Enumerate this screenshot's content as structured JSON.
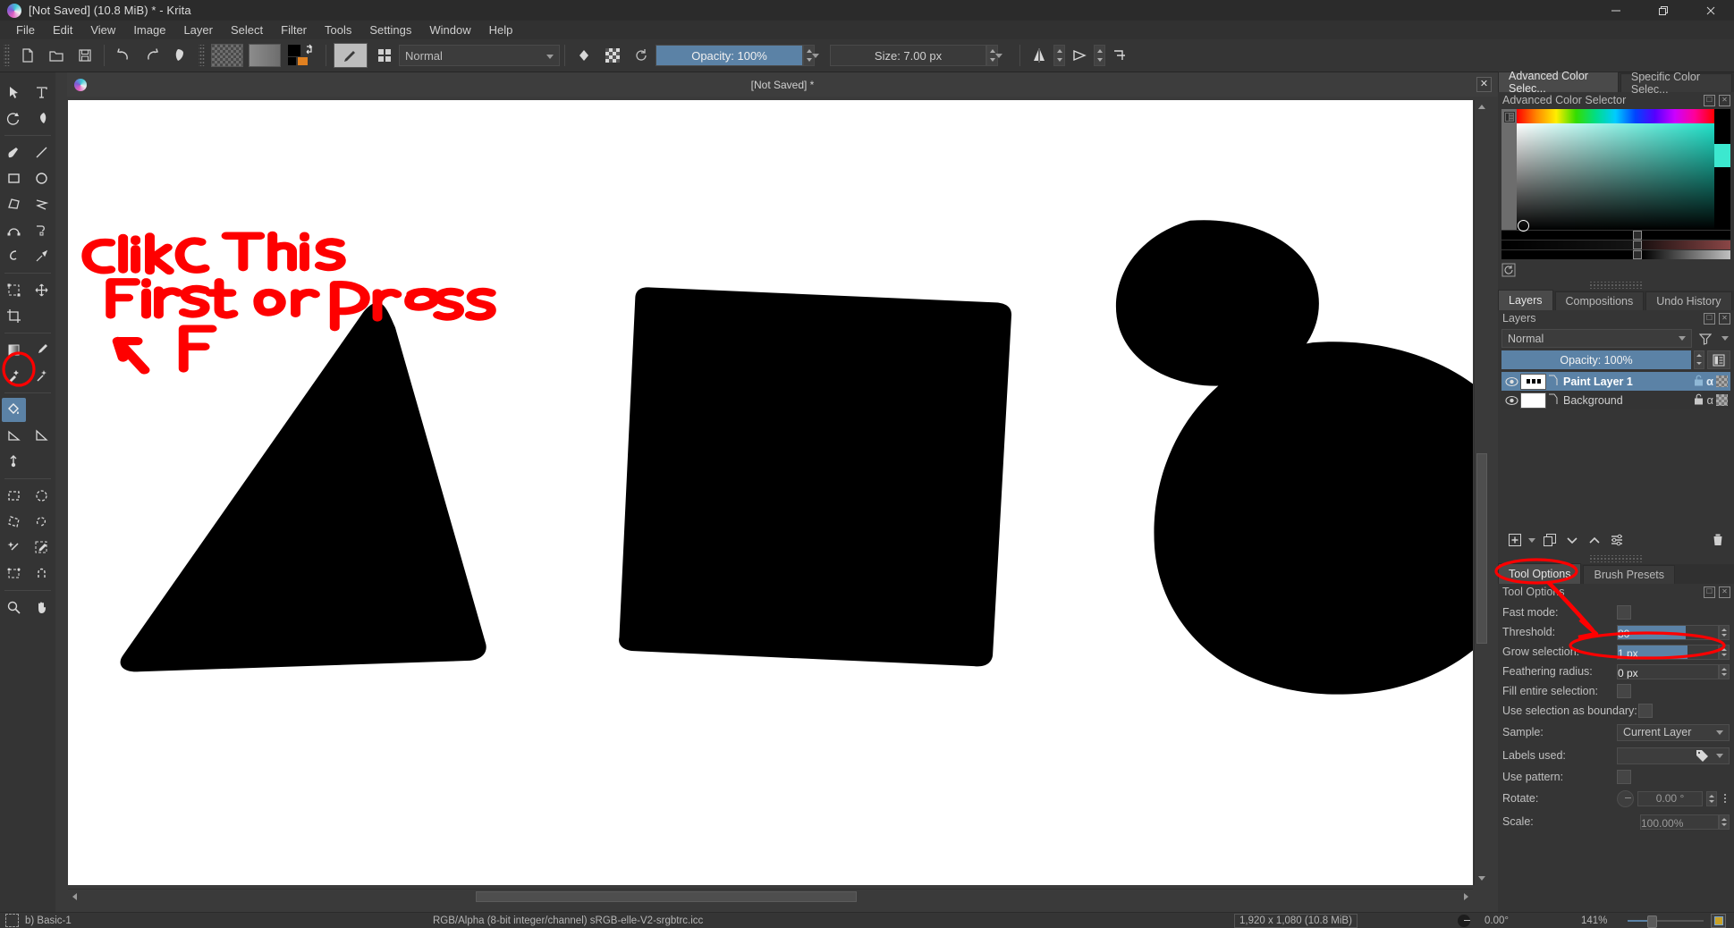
{
  "window": {
    "title": "[Not Saved]  (10.8 MiB)  * - Krita",
    "app_icon": "krita-logo-icon",
    "controls": {
      "minimize": "minimize-icon",
      "maximize": "maximize-icon",
      "close": "close-icon"
    }
  },
  "menu": {
    "items": [
      "File",
      "Edit",
      "View",
      "Image",
      "Layer",
      "Select",
      "Filter",
      "Tools",
      "Settings",
      "Window",
      "Help"
    ]
  },
  "toolbar": {
    "new_label": "new-file-icon",
    "open_label": "open-file-icon",
    "save_label": "save-icon",
    "undo_label": "undo-icon",
    "redo_label": "redo-icon",
    "blend_mode": "Normal",
    "opacity_label": "Opacity: 100%",
    "size_label": "Size: 7.00 px",
    "mirror_h": "mirror-horizontal-icon",
    "mirror_v": "mirror-vertical-icon",
    "wrap": "wrap-around-icon"
  },
  "toolbox": {
    "active_tool": "fill-tool",
    "tools": [
      "select-shapes-tool",
      "text-tool",
      "edit-shapes-tool",
      "calligraphy-tool",
      "freehand-brush-tool",
      "line-tool",
      "rectangle-tool",
      "ellipse-tool",
      "polygon-tool",
      "polyline-tool",
      "bezier-curve-tool",
      "freehand-path-tool",
      "dynamic-brush-tool",
      "multibrush-tool",
      "transform-tool",
      "move-tool",
      "crop-tool",
      "gradient-tool",
      "color-sampler-tool",
      "colorize-mask-tool",
      "smart-patch-tool",
      "fill-tool",
      "measure-tool",
      "assistant-tool",
      "reference-images-tool",
      "rectangular-selection-tool",
      "elliptical-selection-tool",
      "polygonal-selection-tool",
      "freehand-selection-tool",
      "contiguous-selection-tool",
      "similar-color-selection-tool",
      "bezier-selection-tool",
      "magnetic-selection-tool",
      "zoom-tool",
      "pan-tool"
    ]
  },
  "canvas": {
    "tab_title": "[Not Saved]  *",
    "close_label": "✕",
    "annotation_text": "Click This First or Press ← F",
    "annotation_color": "#ff0000",
    "shapes": [
      "triangle",
      "square",
      "small-circle",
      "large-circle"
    ],
    "shape_color": "#000000",
    "background_color": "#ffffff"
  },
  "color_docker": {
    "tabs": [
      "Advanced Color Selec...",
      "Specific Color Selec..."
    ],
    "selected_tab": "Advanced Color Selec...",
    "title": "Advanced Color Selector",
    "current_color": "#3ce8cf"
  },
  "layers_docker": {
    "tabs": [
      "Layers",
      "Compositions",
      "Undo History"
    ],
    "selected_tab": "Layers",
    "title": "Layers",
    "blend_mode": "Normal",
    "opacity_label": "Opacity:  100%",
    "filter_icon": "filter-icon",
    "properties_icon": "layer-properties-icon",
    "layers": [
      {
        "name": "Paint Layer 1",
        "selected": true,
        "visible": true,
        "locked": false,
        "alpha": "α"
      },
      {
        "name": "Background",
        "selected": false,
        "visible": true,
        "locked": true,
        "alpha": "α"
      }
    ],
    "buttons": [
      "add-layer-button",
      "duplicate-layer-button",
      "move-layer-down-button",
      "move-layer-up-button",
      "layer-properties-button",
      "delete-layer-button"
    ]
  },
  "tool_options": {
    "tabs": [
      "Tool Options",
      "Brush Presets"
    ],
    "selected_tab": "Tool Options",
    "title": "Tool Options",
    "rows": [
      {
        "label": "Fast mode:",
        "type": "checkbox",
        "value": ""
      },
      {
        "label": "Threshold:",
        "type": "slider",
        "value": "80",
        "fill": 68
      },
      {
        "label": "Grow selection:",
        "type": "slider",
        "value": "1 px",
        "fill": 70
      },
      {
        "label": "Feathering radius:",
        "type": "slider",
        "value": "0 px",
        "fill": 0
      },
      {
        "label": "Fill entire selection:",
        "type": "checkbox",
        "value": ""
      },
      {
        "label": "Use selection as boundary:",
        "type": "checkbox",
        "value": ""
      },
      {
        "label": "Sample:",
        "type": "combo",
        "value": "Current Layer"
      },
      {
        "label": "Labels used:",
        "type": "combo",
        "value": ""
      },
      {
        "label": "Use pattern:",
        "type": "checkbox",
        "value": ""
      },
      {
        "label": "Rotate:",
        "type": "dial",
        "value": "0.00 °"
      },
      {
        "label": "Scale:",
        "type": "slider",
        "value": "100.00%",
        "fill": 0
      }
    ],
    "highlight_color": "#5b82a6"
  },
  "status_bar": {
    "brush_preset": "b) Basic-1",
    "color_space": "RGB/Alpha (8-bit integer/channel)  sRGB-elle-V2-srgbtrc.icc",
    "dimensions": "1,920 x 1,080 (10.8 MiB)",
    "rotation": "0.00°",
    "zoom": "141%",
    "selection_icon": "selection-icon",
    "fit_icon": "fit-page-icon"
  }
}
